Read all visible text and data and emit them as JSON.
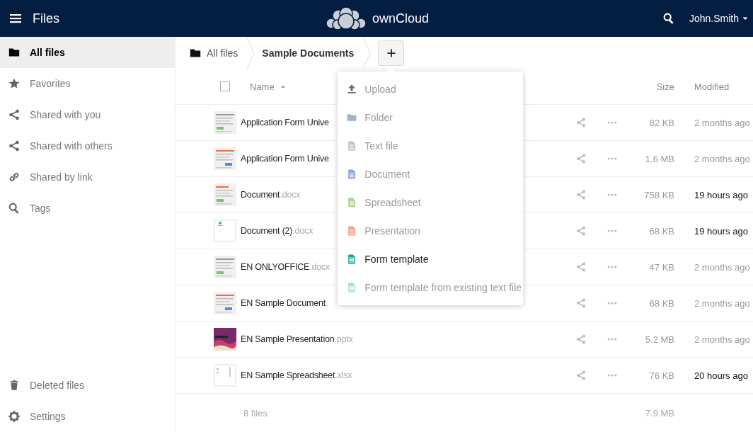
{
  "header": {
    "app_title": "Files",
    "brand": "ownCloud",
    "user": "John.Smith"
  },
  "sidebar": {
    "items": [
      {
        "label": "All files",
        "selected": true
      },
      {
        "label": "Favorites",
        "selected": false
      },
      {
        "label": "Shared with you",
        "selected": false
      },
      {
        "label": "Shared with others",
        "selected": false
      },
      {
        "label": "Shared by link",
        "selected": false
      },
      {
        "label": "Tags",
        "selected": false
      }
    ],
    "bottom_items": [
      {
        "label": "Deleted files"
      },
      {
        "label": "Settings"
      }
    ]
  },
  "breadcrumbs": [
    {
      "label": "All files",
      "current": false
    },
    {
      "label": "Sample Documents",
      "current": true
    }
  ],
  "new_menu": {
    "items": [
      {
        "label": "Upload",
        "kind": "upload",
        "color": "#6b6b6b",
        "selected": false
      },
      {
        "label": "Folder",
        "kind": "folder",
        "color": "#a3b3cc",
        "selected": false
      },
      {
        "label": "Text file",
        "kind": "file",
        "color": "#c4c4c4",
        "selected": false
      },
      {
        "label": "Document",
        "kind": "file",
        "color": "#8da4dc",
        "selected": false
      },
      {
        "label": "Spreadsheet",
        "kind": "file",
        "color": "#b5d08f",
        "selected": false
      },
      {
        "label": "Presentation",
        "kind": "file",
        "color": "#f0a387",
        "selected": false
      },
      {
        "label": "Form template",
        "kind": "form",
        "color": "#1aa08a",
        "selected": true
      },
      {
        "label": "Form template from existing text file",
        "kind": "form",
        "color": "#a3dcd2",
        "selected": false
      }
    ]
  },
  "table": {
    "columns": {
      "name": "Name",
      "size": "Size",
      "modified": "Modified"
    },
    "select_all": {
      "checked": false
    },
    "rows": [
      {
        "name": "Application Form Unive",
        "ext": "",
        "size": "82 KB",
        "modified": "2 months ago",
        "recent": false
      },
      {
        "name": "Application Form Unive",
        "ext": "",
        "size": "1.6 MB",
        "modified": "2 months ago",
        "recent": false
      },
      {
        "name": "Document",
        "ext": ".docx",
        "size": "758 KB",
        "modified": "19 hours ago",
        "recent": true
      },
      {
        "name": "Document (2)",
        "ext": ".docx",
        "size": "68 KB",
        "modified": "19 hours ago",
        "recent": true
      },
      {
        "name": "EN ONLYOFFICE",
        "ext": ".docx",
        "size": "47 KB",
        "modified": "2 months ago",
        "recent": false
      },
      {
        "name": "EN Sample Document",
        "ext": ".",
        "size": "68 KB",
        "modified": "2 months ago",
        "recent": false
      },
      {
        "name": "EN Sample Presentation",
        "ext": ".pptx",
        "size": "5.2 MB",
        "modified": "2 months ago",
        "recent": false
      },
      {
        "name": "EN Sample Spreadsheet",
        "ext": ".xlsx",
        "size": "76 KB",
        "modified": "20 hours ago",
        "recent": true
      }
    ],
    "summary": {
      "count": "8 files",
      "size": "7.9 MB"
    }
  }
}
